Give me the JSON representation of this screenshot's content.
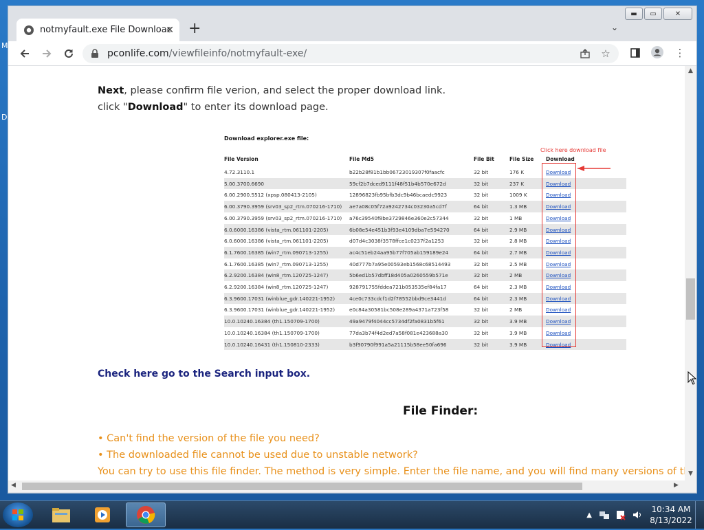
{
  "desktop": {
    "letter1": "M",
    "letter2": "D"
  },
  "browser": {
    "tab_title": "notmyfault.exe File Download & ...",
    "new_tab": "+",
    "url_host": "pconlife.com",
    "url_path": "/viewfileinfo/notmyfault-exe/"
  },
  "page": {
    "line1_bold": "Next",
    "line1_rest": ", please confirm file verion, and select the proper download link.",
    "line2_pre": "click \"",
    "line2_bold": "Download",
    "line2_post": "\" to enter its download page.",
    "search_link": "Check here go to the Search input box.",
    "finder_title": "File Finder:",
    "bullet1": "• Can't find the version of the file you need?",
    "bullet2": "• The downloaded file cannot be used due to unstable network?",
    "finder_text": "You can try to use this file finder. The method is very simple. Enter the file name, and you will find many versions of this file. S"
  },
  "table": {
    "heading": "Download explorer.exe file:",
    "click_note": "Click here download file",
    "headers": {
      "version": "File Version",
      "md5": "File Md5",
      "bit": "File Bit",
      "size": "File Size",
      "download": "Download"
    },
    "rows": [
      {
        "version": "4.72.3110.1",
        "md5": "b22b28f81b1bb06723019307f0faacfc",
        "bit": "32 bit",
        "size": "176 K",
        "dl": "Download"
      },
      {
        "version": "5.00.3700.6690",
        "md5": "59cf2b7dced9111f48f51b4b570e672d",
        "bit": "32 bit",
        "size": "237 K",
        "dl": "Download"
      },
      {
        "version": "6.00.2900.5512 (xpsp.080413-2105)",
        "md5": "12896823fb95bfb3dc9b46bcaedc9923",
        "bit": "32 bit",
        "size": "1009 K",
        "dl": "Download"
      },
      {
        "version": "6.00.3790.3959 (srv03_sp2_rtm.070216-1710)",
        "md5": "ae7a08c05f72a9242734c03230a5cd7f",
        "bit": "64 bit",
        "size": "1.3 MB",
        "dl": "Download"
      },
      {
        "version": "6.00.3790.3959 (srv03_sp2_rtm.070216-1710)",
        "md5": "a76c39540f8be3729846e360e2c57344",
        "bit": "32 bit",
        "size": "1 MB",
        "dl": "Download"
      },
      {
        "version": "6.0.6000.16386 (vista_rtm.061101-2205)",
        "md5": "6b08e54e451b3f93e4109dba7e594270",
        "bit": "64 bit",
        "size": "2.9 MB",
        "dl": "Download"
      },
      {
        "version": "6.0.6000.16386 (vista_rtm.061101-2205)",
        "md5": "d07d4c3038f3578ffce1c0237f2a1253",
        "bit": "32 bit",
        "size": "2.8 MB",
        "dl": "Download"
      },
      {
        "version": "6.1.7600.16385 (win7_rtm.090713-1255)",
        "md5": "ac4c51eb24aa95b77f705ab159189e24",
        "bit": "64 bit",
        "size": "2.7 MB",
        "dl": "Download"
      },
      {
        "version": "6.1.7600.16385 (win7_rtm.090713-1255)",
        "md5": "40d777b7a95e00593eb1568c68514493",
        "bit": "32 bit",
        "size": "2.5 MB",
        "dl": "Download"
      },
      {
        "version": "6.2.9200.16384 (win8_rtm.120725-1247)",
        "md5": "5b6ed1b57dbff18d405a0260559b571e",
        "bit": "32 bit",
        "size": "2 MB",
        "dl": "Download"
      },
      {
        "version": "6.2.9200.16384 (win8_rtm.120725-1247)",
        "md5": "928791755fddea721b053535ef84fa17",
        "bit": "64 bit",
        "size": "2.3 MB",
        "dl": "Download"
      },
      {
        "version": "6.3.9600.17031 (winblue_gdr.140221-1952)",
        "md5": "4ce0c733cdcf1d2f78552bbd9ce3441d",
        "bit": "64 bit",
        "size": "2.3 MB",
        "dl": "Download"
      },
      {
        "version": "6.3.9600.17031 (winblue_gdr.140221-1952)",
        "md5": "e0c84a30581bc508e289a4371a723f58",
        "bit": "32 bit",
        "size": "2 MB",
        "dl": "Download"
      },
      {
        "version": "10.0.10240.16384 (th1.150709-1700)",
        "md5": "49a9479f4044cc5734df2fa0831b5f61",
        "bit": "32 bit",
        "size": "3.9 MB",
        "dl": "Download"
      },
      {
        "version": "10.0.10240.16384 (th1.150709-1700)",
        "md5": "77da3b74f4d2ed7a58f081e423688a30",
        "bit": "32 bit",
        "size": "3.9 MB",
        "dl": "Download"
      },
      {
        "version": "10.0.10240.16431 (th1.150810-2333)",
        "md5": "b3f90790f991a5a21115b58ee50fa696",
        "bit": "32 bit",
        "size": "3.9 MB",
        "dl": "Download"
      }
    ]
  },
  "taskbar": {
    "time": "10:34 AM",
    "date": "8/13/2022"
  },
  "colors": {
    "link_blue": "#1a237e",
    "orange": "#e8901a",
    "red_highlight": "#e53935"
  }
}
